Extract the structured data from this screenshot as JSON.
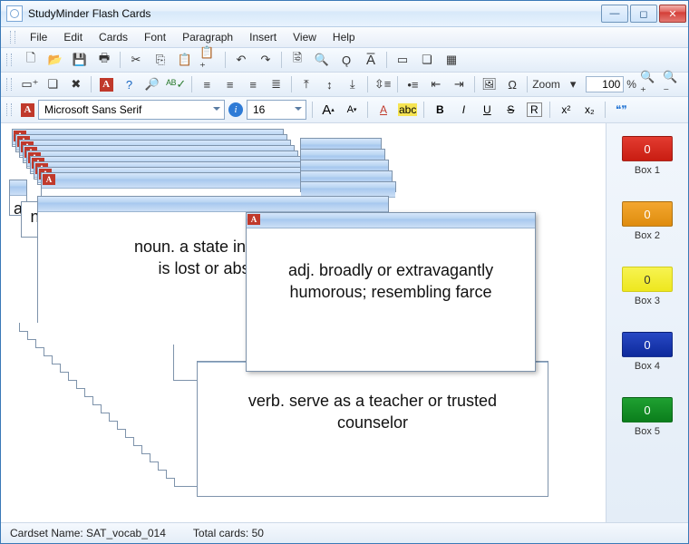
{
  "title": "StudyMinder Flash Cards",
  "menu": [
    "File",
    "Edit",
    "Cards",
    "Font",
    "Paragraph",
    "Insert",
    "View",
    "Help"
  ],
  "zoom": {
    "label": "Zoom",
    "value": "100",
    "pct": "%"
  },
  "font": {
    "name": "Microsoft Sans Serif",
    "size": "16",
    "bigA": "A",
    "smallA": "A",
    "colorA": "A",
    "hiAbc": "abc",
    "B": "B",
    "I": "I",
    "U": "U",
    "S": "S",
    "R": "R",
    "sup": "x²",
    "sub": "x₂",
    "info": "i"
  },
  "boxes": [
    {
      "count": "0",
      "label": "Box 1"
    },
    {
      "count": "0",
      "label": "Box 2"
    },
    {
      "count": "0",
      "label": "Box 3"
    },
    {
      "count": "0",
      "label": "Box 4"
    },
    {
      "count": "0",
      "label": "Box 5"
    }
  ],
  "cards": {
    "back_stack_text": "a",
    "noun_fragment": "n",
    "mid_text": "noun. a state in which\nis lost or absen",
    "popup_text": "adj. broadly or extravagantly humorous; resembling farce",
    "lower_a": "a",
    "bottom_text": "verb. serve as a teacher or trusted counselor"
  },
  "status": {
    "cardset_label": "Cardset Name:",
    "cardset_name": "SAT_vocab_014",
    "total_label": "Total cards:",
    "total": "50"
  }
}
